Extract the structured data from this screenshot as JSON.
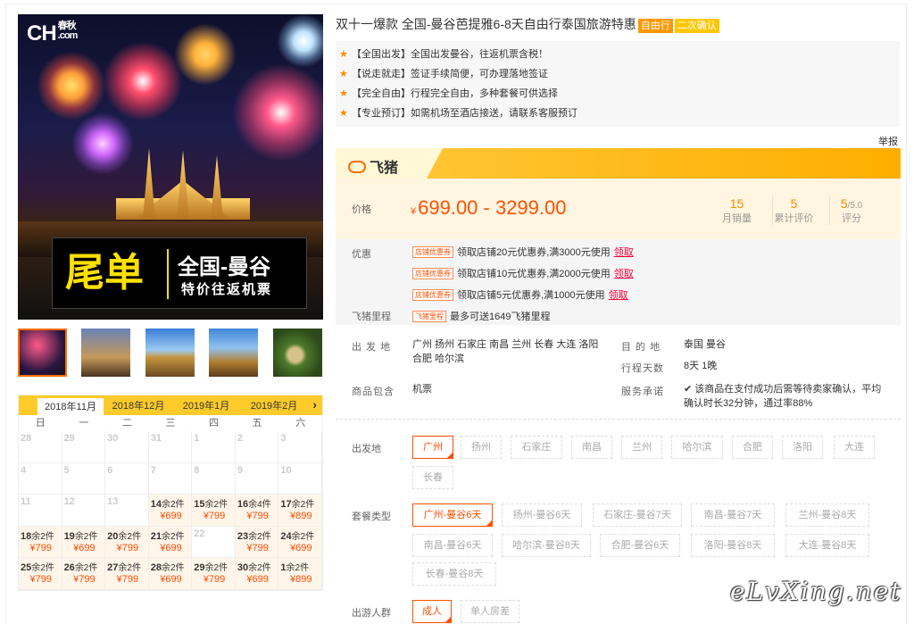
{
  "hero": {
    "logo_text": "CH",
    "logo_sub_top": "春秋",
    "logo_sub_bottom": ".com",
    "banner_big": "尾单",
    "banner_line1": "全国-曼谷",
    "banner_line2": "特价往返机票"
  },
  "product": {
    "title": "双十一爆款 全国-曼谷芭提雅6-8天自由行泰国旅游特惠",
    "tag1": "自由行",
    "tag2": "二次确认",
    "features": [
      "【全国出发】全国出发曼谷，往返机票含税！",
      "【说走就走】签证手续简便，可办理落地签证",
      "【完全自由】行程完全自由，多种套餐可供选择",
      "【专业预订】如需机场至酒店接送，请联系客服预订"
    ],
    "report": "举报"
  },
  "brand": {
    "name": "飞猪"
  },
  "price": {
    "label": "价格",
    "currency": "¥",
    "range": "699.00 - 3299.00",
    "stats": [
      {
        "value": "15",
        "suffix": "",
        "label": "月销量"
      },
      {
        "value": "5",
        "suffix": "",
        "label": "累计评价"
      },
      {
        "value": "5",
        "suffix": "/5.0",
        "label": "评分"
      }
    ]
  },
  "promo": {
    "label": "优惠",
    "coupon_tag": "店铺优惠券",
    "coupons": [
      "领取店铺20元优惠券,满3000元使用",
      "领取店铺10元优惠券,满2000元使用",
      "领取店铺5元优惠券,满1000元使用"
    ],
    "claim": "领取",
    "mileage_label": "飞猪里程",
    "mileage_tag": "飞猪里程",
    "mileage_text": "最多可送1649飞猪里程"
  },
  "info": {
    "from_label": "出 发 地",
    "from_value": "广州 扬州 石家庄 南昌 兰州 长春 大连 洛阳 合肥 哈尔滨",
    "dest_label": "目 的 地",
    "dest_value": "泰国 曼谷",
    "days_label": "行程天数",
    "days_value": "8天 1晚",
    "include_label": "商品包含",
    "include_value": "机票",
    "service_label": "服务承诺",
    "service_value": "该商品在支付成功后需等待卖家确认，平均确认时长32分钟，通过率88%"
  },
  "options": {
    "departure_label": "出发地",
    "departures": [
      "广州",
      "扬州",
      "石家庄",
      "南昌",
      "兰州",
      "哈尔滨",
      "合肥",
      "洛阳",
      "大连",
      "长春"
    ],
    "package_label": "套餐类型",
    "packages": [
      "广州-曼谷6天",
      "扬州-曼谷6天",
      "石家庄-曼谷7天",
      "南昌-曼谷7天",
      "兰州-曼谷8天",
      "南昌-曼谷6天",
      "哈尔滨-曼谷8天",
      "合肥-曼谷6天",
      "洛阳-曼谷8天",
      "大连-曼谷8天",
      "长春-曼谷8天"
    ],
    "traveler_label": "出游人群",
    "travelers": [
      "成人",
      "单人房差"
    ]
  },
  "calendar": {
    "tabs": [
      "2018年11月",
      "2018年12月",
      "2019年1月",
      "2019年2月"
    ],
    "next": "›",
    "weekdays": [
      "日",
      "一",
      "二",
      "三",
      "四",
      "五",
      "六"
    ],
    "cells": [
      {
        "d": "28",
        "rem": "",
        "price": ""
      },
      {
        "d": "29",
        "rem": "",
        "price": ""
      },
      {
        "d": "30",
        "rem": "",
        "price": ""
      },
      {
        "d": "31",
        "rem": "",
        "price": ""
      },
      {
        "d": "1",
        "rem": "",
        "price": ""
      },
      {
        "d": "2",
        "rem": "",
        "price": ""
      },
      {
        "d": "3",
        "rem": "",
        "price": ""
      },
      {
        "d": "4",
        "rem": "",
        "price": ""
      },
      {
        "d": "5",
        "rem": "",
        "price": ""
      },
      {
        "d": "6",
        "rem": "",
        "price": ""
      },
      {
        "d": "7",
        "rem": "",
        "price": ""
      },
      {
        "d": "8",
        "rem": "",
        "price": ""
      },
      {
        "d": "9",
        "rem": "",
        "price": ""
      },
      {
        "d": "10",
        "rem": "",
        "price": ""
      },
      {
        "d": "11",
        "rem": "",
        "price": ""
      },
      {
        "d": "12",
        "rem": "",
        "price": ""
      },
      {
        "d": "13",
        "rem": "",
        "price": ""
      },
      {
        "d": "14",
        "rem": "余2件",
        "price": "¥699"
      },
      {
        "d": "15",
        "rem": "余2件",
        "price": "¥799"
      },
      {
        "d": "16",
        "rem": "余4件",
        "price": "¥799"
      },
      {
        "d": "17",
        "rem": "余2件",
        "price": "¥899"
      },
      {
        "d": "18",
        "rem": "余2件",
        "price": "¥799"
      },
      {
        "d": "19",
        "rem": "余2件",
        "price": "¥699"
      },
      {
        "d": "20",
        "rem": "余2件",
        "price": "¥799"
      },
      {
        "d": "21",
        "rem": "余2件",
        "price": "¥699"
      },
      {
        "d": "22",
        "rem": "",
        "price": ""
      },
      {
        "d": "23",
        "rem": "余2件",
        "price": "¥799"
      },
      {
        "d": "24",
        "rem": "余2件",
        "price": "¥699"
      },
      {
        "d": "25",
        "rem": "余2件",
        "price": "¥799"
      },
      {
        "d": "26",
        "rem": "余2件",
        "price": "¥799"
      },
      {
        "d": "27",
        "rem": "余2件",
        "price": "¥799"
      },
      {
        "d": "28",
        "rem": "余2件",
        "price": "¥699"
      },
      {
        "d": "29",
        "rem": "余2件",
        "price": "¥799"
      },
      {
        "d": "30",
        "rem": "余2件",
        "price": "¥699"
      },
      {
        "d": "1",
        "rem": "余2件",
        "price": "¥899"
      }
    ]
  },
  "watermark": "eLvXing.net"
}
